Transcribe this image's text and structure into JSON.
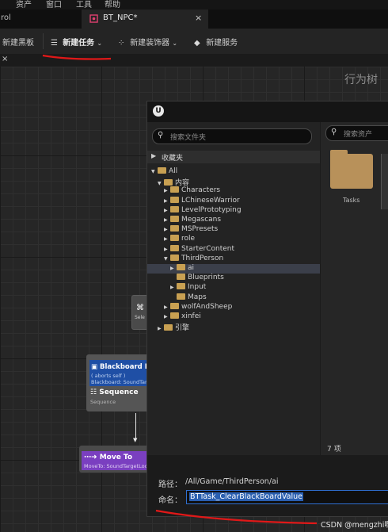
{
  "menubar": {
    "items": [
      "资产",
      "窗口",
      "工具",
      "帮助"
    ]
  },
  "tabs": {
    "left_tab": "rol",
    "active_tab": "BT_NPC*",
    "close_glyph": "×"
  },
  "toolbar": {
    "new_blackboard": "新建黑板",
    "new_task": "新建任务",
    "new_decorator": "新建装饰器",
    "new_service": "新建服务"
  },
  "graph": {
    "panel_close": "×",
    "title": "行为树"
  },
  "nodes": {
    "blackboard_title": "Blackboard B",
    "blackboard_sub1": "( aborts self )",
    "blackboard_sub2": "Blackboard: SoundTar",
    "sequence_title": "Sequence",
    "sequence_sub": "Sequence",
    "selector_label": "Sele",
    "moveto_title": "Move To",
    "moveto_sub": "MoveTo: SoundTargetLoc"
  },
  "dialog": {
    "folder_search_placeholder": "搜索文件夹",
    "asset_search_placeholder": "搜索资产",
    "favorites": "收藏夹",
    "tree": [
      {
        "label": "All",
        "depth": 0,
        "expanded": true
      },
      {
        "label": "内容",
        "depth": 1,
        "expanded": true
      },
      {
        "label": "Characters",
        "depth": 2
      },
      {
        "label": "LChineseWarrior",
        "depth": 2
      },
      {
        "label": "LevelPrototyping",
        "depth": 2
      },
      {
        "label": "Megascans",
        "depth": 2
      },
      {
        "label": "MSPresets",
        "depth": 2
      },
      {
        "label": "role",
        "depth": 2
      },
      {
        "label": "StarterContent",
        "depth": 2
      },
      {
        "label": "ThirdPerson",
        "depth": 2,
        "expanded": true
      },
      {
        "label": "ai",
        "depth": 3,
        "selected": true
      },
      {
        "label": "Blueprints",
        "depth": 3,
        "leaf": true
      },
      {
        "label": "Input",
        "depth": 3
      },
      {
        "label": "Maps",
        "depth": 3,
        "leaf": true
      },
      {
        "label": "wolfAndSheep",
        "depth": 2
      },
      {
        "label": "xinfei",
        "depth": 2
      },
      {
        "label": "引擎",
        "depth": 1
      }
    ],
    "asset_tile": "Tasks",
    "item_count": "7 项",
    "path_label": "路径：",
    "path_value": "/All/Game/ThirdPerson/ai",
    "name_label": "命名：",
    "name_value": "BTTask_ClearBlackBoardValue"
  },
  "watermark": "CSDN @mengzhi啊",
  "colors": {
    "accent_blue": "#2a5fb0",
    "blackboard_node": "#1f4fa5",
    "moveto_node": "#7a3fc0",
    "annotation_red": "#e01818"
  }
}
